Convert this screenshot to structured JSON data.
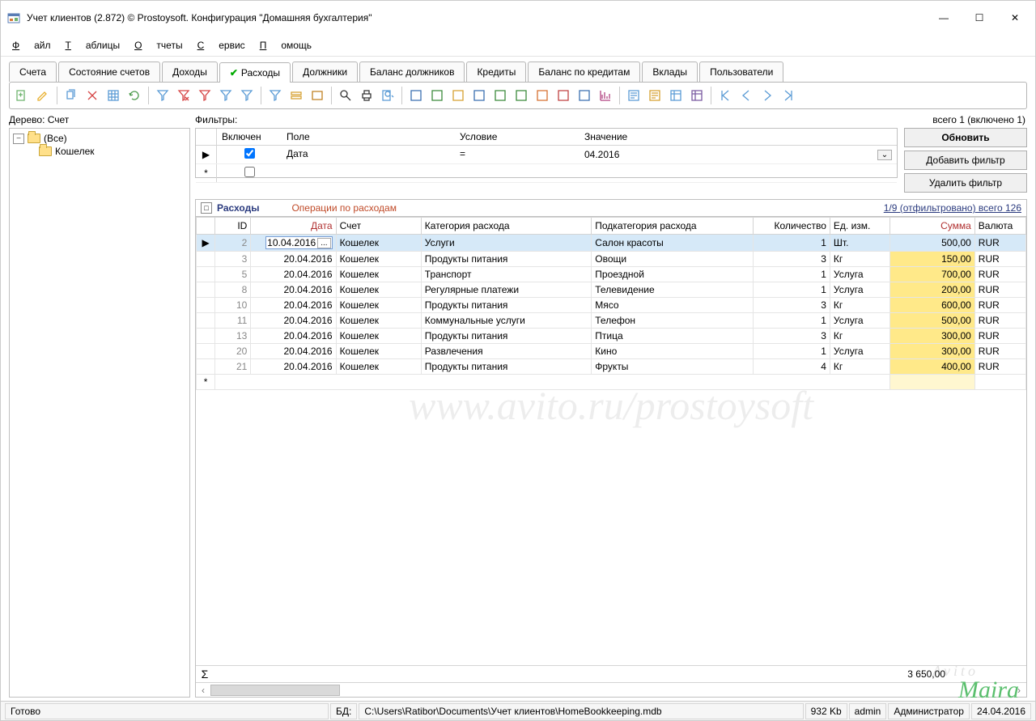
{
  "title": "Учет клиентов (2.872) © Prostoysoft. Конфигурация \"Домашняя бухгалтерия\"",
  "menu": [
    "Файл",
    "Таблицы",
    "Отчеты",
    "Сервис",
    "Помощь"
  ],
  "tabs": [
    "Счета",
    "Состояние счетов",
    "Доходы",
    "Расходы",
    "Должники",
    "Баланс должников",
    "Кредиты",
    "Баланс по кредитам",
    "Вклады",
    "Пользователи"
  ],
  "active_tab_index": 3,
  "tree": {
    "label": "Дерево: Счет",
    "root": "(Все)",
    "items": [
      "Кошелек"
    ]
  },
  "filters": {
    "label": "Фильтры:",
    "total_label": "всего 1 (включено 1)",
    "cols": {
      "enabled": "Включен",
      "field": "Поле",
      "cond": "Условие",
      "value": "Значение"
    },
    "row": {
      "field": "Дата",
      "cond": "=",
      "value": "04.2016"
    },
    "buttons": {
      "update": "Обновить",
      "add": "Добавить фильтр",
      "del": "Удалить фильтр"
    }
  },
  "section": {
    "title": "Расходы",
    "desc": "Операции по расходам",
    "stat": "1/9 (отфильтровано) всего 126"
  },
  "grid": {
    "cols": {
      "id": "ID",
      "date": "Дата",
      "acct": "Счет",
      "cat": "Категория расхода",
      "subcat": "Подкатегория расхода",
      "qty": "Количество",
      "unit": "Ед. изм.",
      "sum": "Сумма",
      "cur": "Валюта"
    },
    "rows": [
      {
        "id": "2",
        "date": "10.04.2016",
        "acct": "Кошелек",
        "cat": "Услуги",
        "subcat": "Салон красоты",
        "qty": "1",
        "unit": "Шт.",
        "sum": "500,00",
        "cur": "RUR",
        "sel": true,
        "hl": false
      },
      {
        "id": "3",
        "date": "20.04.2016",
        "acct": "Кошелек",
        "cat": "Продукты питания",
        "subcat": "Овощи",
        "qty": "3",
        "unit": "Кг",
        "sum": "150,00",
        "cur": "RUR",
        "sel": false,
        "hl": true
      },
      {
        "id": "5",
        "date": "20.04.2016",
        "acct": "Кошелек",
        "cat": "Транспорт",
        "subcat": "Проездной",
        "qty": "1",
        "unit": "Услуга",
        "sum": "700,00",
        "cur": "RUR",
        "sel": false,
        "hl": true
      },
      {
        "id": "8",
        "date": "20.04.2016",
        "acct": "Кошелек",
        "cat": "Регулярные платежи",
        "subcat": "Телевидение",
        "qty": "1",
        "unit": "Услуга",
        "sum": "200,00",
        "cur": "RUR",
        "sel": false,
        "hl": true
      },
      {
        "id": "10",
        "date": "20.04.2016",
        "acct": "Кошелек",
        "cat": "Продукты питания",
        "subcat": "Мясо",
        "qty": "3",
        "unit": "Кг",
        "sum": "600,00",
        "cur": "RUR",
        "sel": false,
        "hl": true
      },
      {
        "id": "11",
        "date": "20.04.2016",
        "acct": "Кошелек",
        "cat": "Коммунальные услуги",
        "subcat": "Телефон",
        "qty": "1",
        "unit": "Услуга",
        "sum": "500,00",
        "cur": "RUR",
        "sel": false,
        "hl": true
      },
      {
        "id": "13",
        "date": "20.04.2016",
        "acct": "Кошелек",
        "cat": "Продукты питания",
        "subcat": "Птица",
        "qty": "3",
        "unit": "Кг",
        "sum": "300,00",
        "cur": "RUR",
        "sel": false,
        "hl": true
      },
      {
        "id": "20",
        "date": "20.04.2016",
        "acct": "Кошелек",
        "cat": "Развлечения",
        "subcat": "Кино",
        "qty": "1",
        "unit": "Услуга",
        "sum": "300,00",
        "cur": "RUR",
        "sel": false,
        "hl": true
      },
      {
        "id": "21",
        "date": "20.04.2016",
        "acct": "Кошелек",
        "cat": "Продукты питания",
        "subcat": "Фрукты",
        "qty": "4",
        "unit": "Кг",
        "sum": "400,00",
        "cur": "RUR",
        "sel": false,
        "hl": true
      }
    ],
    "sum_total": "3 650,00"
  },
  "status": {
    "ready": "Готово",
    "db_label": "БД:",
    "db_path": "C:\\Users\\Ratibor\\Documents\\Учет клиентов\\HomeBookkeeping.mdb",
    "size": "932 Kb",
    "user": "admin",
    "role": "Администратор",
    "date": "24.04.2016"
  },
  "watermarks": {
    "main": "www.avito.ru/prostoysoft",
    "small": "Avito",
    "corner": "Maira"
  }
}
